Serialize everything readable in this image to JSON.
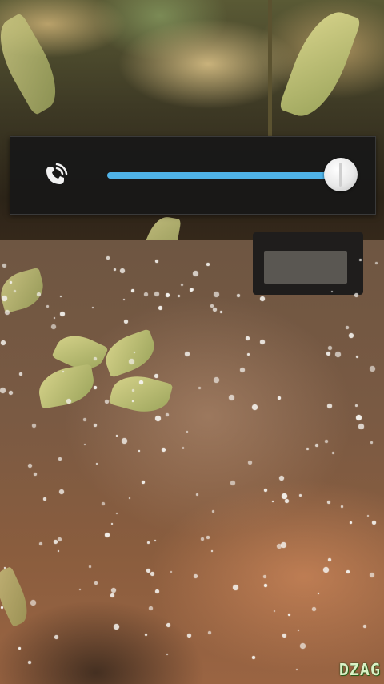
{
  "volume_overlay": {
    "stream_icon": "phone-call-icon",
    "level_fraction": 1.0,
    "accent_color": "#4fb3e8"
  },
  "watermark": {
    "text": "DZAG"
  },
  "background": {
    "description_icon": "photo-background"
  }
}
